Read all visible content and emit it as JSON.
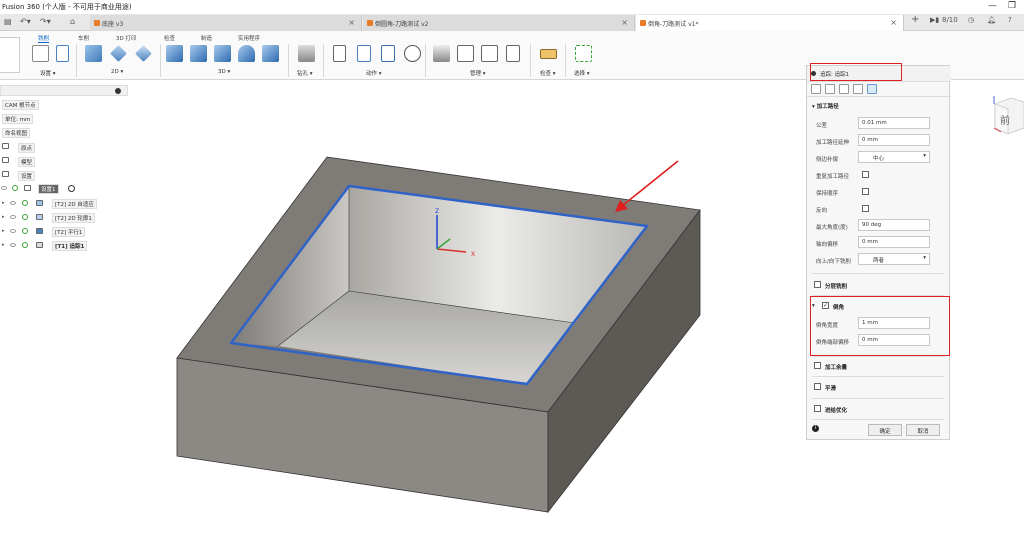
{
  "window": {
    "title": "Fusion 360 (个人版 - 不可用于商业用途)"
  },
  "doc_tabs": [
    {
      "label": "底座 v3",
      "active": false
    },
    {
      "label": "倒圆角-刀路测试 v2",
      "active": false
    },
    {
      "label": "倒角-刀路测试 v1*",
      "active": true
    }
  ],
  "tab_controls": {
    "count": "8/10"
  },
  "ribbon": {
    "tabs": [
      {
        "label": "铣削",
        "active": true
      },
      {
        "label": "车削",
        "active": false
      },
      {
        "label": "3D 打印",
        "active": false
      },
      {
        "label": "检查",
        "active": false
      },
      {
        "label": "制造",
        "active": false
      },
      {
        "label": "实用程序",
        "active": false
      }
    ],
    "groups": [
      "设置 ▾",
      "2D ▾",
      "3D ▾",
      "钻孔 ▾",
      "动作 ▾",
      "管理 ▾",
      "检查 ▾",
      "选择 ▾"
    ]
  },
  "browser": {
    "root": "CAM 根节点",
    "units": "单位: mm",
    "named_views": "命名视图",
    "nodes": [
      "原点",
      "模型",
      "设置"
    ],
    "setup_chip": "设置1",
    "operations": [
      "[T2] 2D 自适应",
      "[T2] 2D 轮廓1",
      "[T2] 平行1",
      "[T1] 追踪1"
    ]
  },
  "panel": {
    "header": "追踪: 追踪1",
    "section_toolpath": "加工路径",
    "labels": {
      "tolerance": "公差",
      "extension": "加工路径延伸",
      "sideways_comp": "侧边补偿",
      "repeat_pass": "重复加工路径",
      "keep_order": "保持顺序",
      "reverse": "反向",
      "max_angle": "最大角度(度)",
      "axial_offset": "轴向偏移",
      "up_down_milling": "向上/向下铣削"
    },
    "values": {
      "tolerance": "0.01 mm",
      "extension": "0 mm",
      "sideways_comp": "中心",
      "max_angle": "90 deg",
      "axial_offset": "0 mm",
      "up_down_milling": "两者"
    },
    "section_multiple_depths": "分层铣削",
    "section_chamfer": "倒角",
    "chamfer_labels": {
      "width": "倒角宽度",
      "tip_offset": "倒角端部偏移"
    },
    "chamfer_values": {
      "width": "1 mm",
      "tip_offset": "0 mm"
    },
    "section_stock": "加工余量",
    "section_smoothing": "平滑",
    "section_feed_opt": "进给优化",
    "ok_label": "确定",
    "cancel_label": "取消"
  },
  "viewcube": {
    "face": "前"
  },
  "colors": {
    "accent": "#0a64c8",
    "highlight": "#e02020",
    "toolpath": "#2f63c8"
  }
}
